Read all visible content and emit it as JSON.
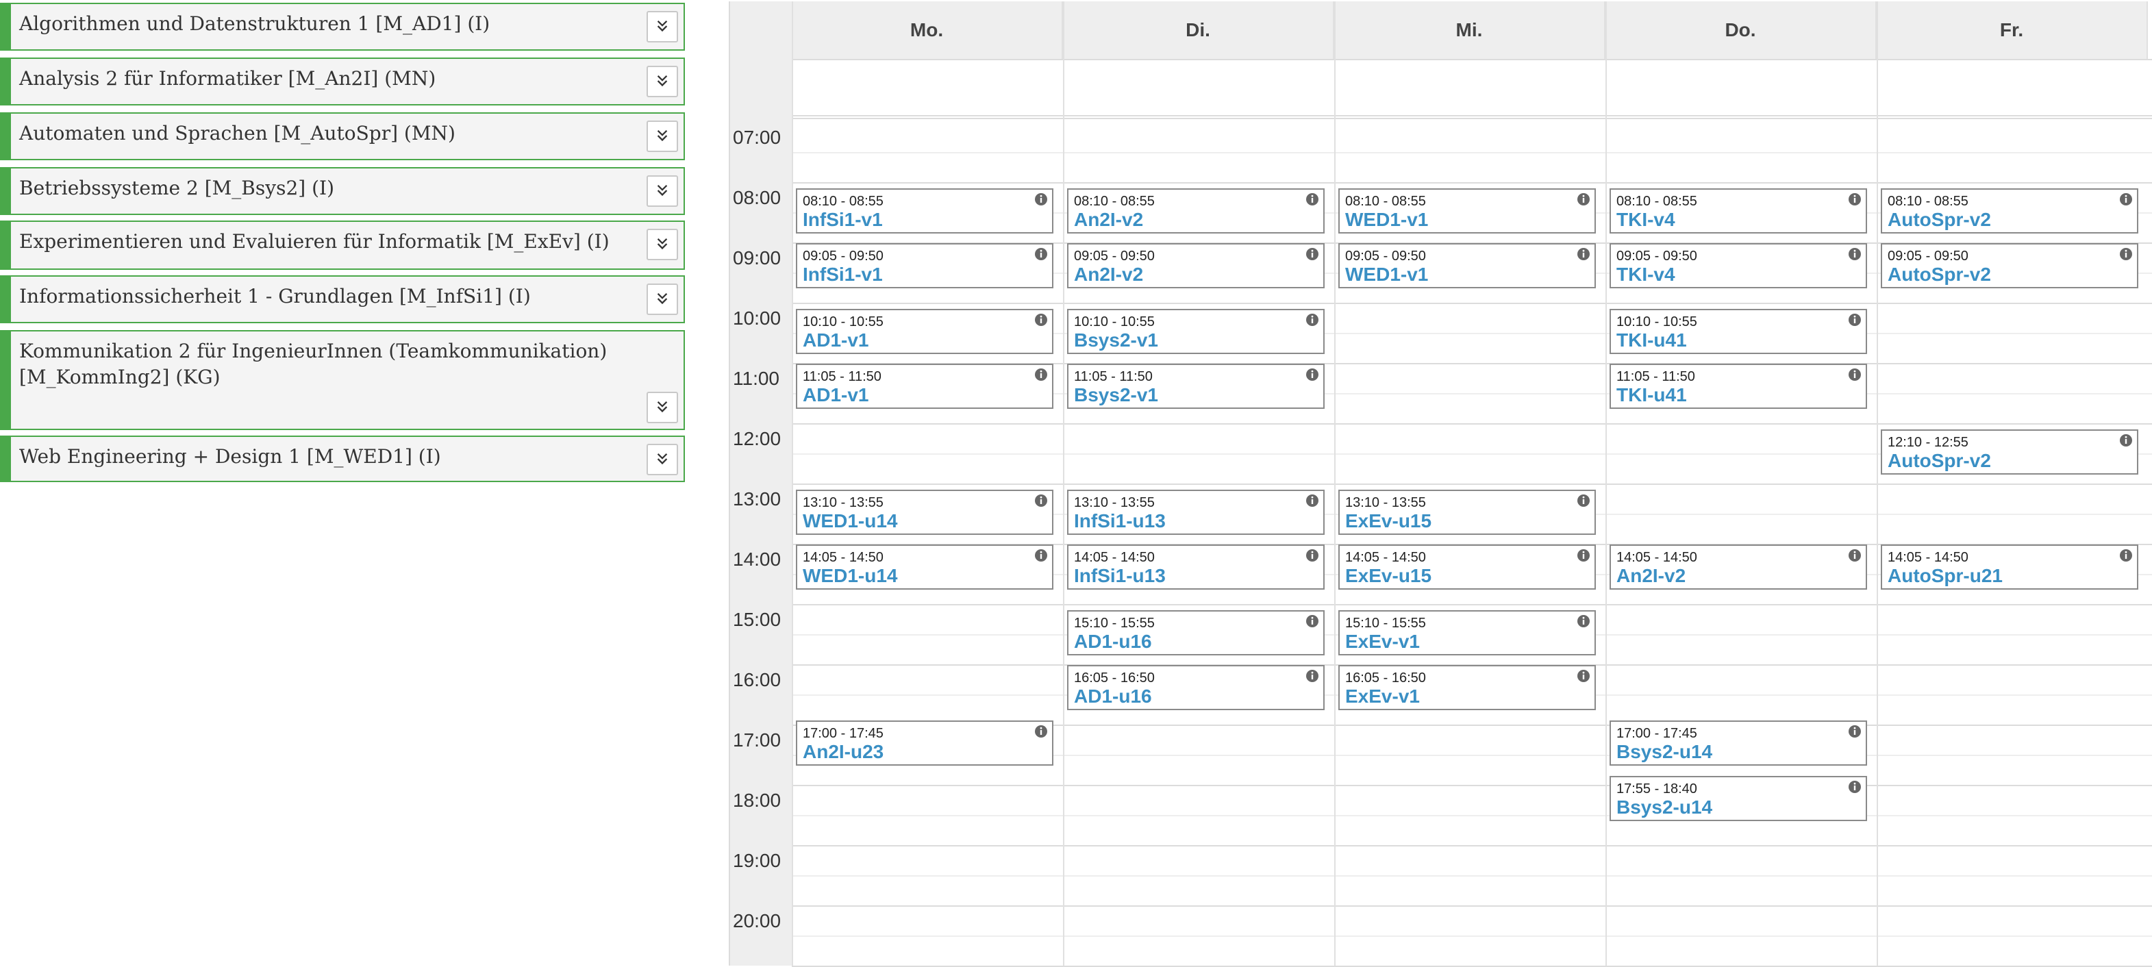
{
  "courses": [
    {
      "title": "Algorithmen und Datenstrukturen 1 [M_AD1] (I)"
    },
    {
      "title": "Analysis 2 für Informatiker [M_An2I] (MN)"
    },
    {
      "title": "Automaten und Sprachen [M_AutoSpr] (MN)"
    },
    {
      "title": "Betriebssysteme 2 [M_Bsys2] (I)"
    },
    {
      "title": "Experimentieren und Evaluieren für Informatik [M_ExEv] (I)"
    },
    {
      "title": "Informationssicherheit 1 - Grundlagen [M_InfSi1] (I)"
    },
    {
      "title": "Kommunikation 2 für IngenieurInnen (Teamkommunikation) [M_KommIng2] (KG)"
    },
    {
      "title": "Web Engineering + Design 1 [M_WED1] (I)"
    }
  ],
  "calendar": {
    "days": [
      "Mo.",
      "Di.",
      "Mi.",
      "Do.",
      "Fr."
    ],
    "hours": [
      "07:00",
      "08:00",
      "09:00",
      "10:00",
      "11:00",
      "12:00",
      "13:00",
      "14:00",
      "15:00",
      "16:00",
      "17:00",
      "18:00",
      "19:00",
      "20:00"
    ],
    "events": [
      {
        "day": 0,
        "time": "08:10 - 08:55",
        "name": "InfSi1-v1"
      },
      {
        "day": 1,
        "time": "08:10 - 08:55",
        "name": "An2I-v2"
      },
      {
        "day": 2,
        "time": "08:10 - 08:55",
        "name": "WED1-v1"
      },
      {
        "day": 3,
        "time": "08:10 - 08:55",
        "name": "TKI-v4"
      },
      {
        "day": 4,
        "time": "08:10 - 08:55",
        "name": "AutoSpr-v2"
      },
      {
        "day": 0,
        "time": "09:05 - 09:50",
        "name": "InfSi1-v1"
      },
      {
        "day": 1,
        "time": "09:05 - 09:50",
        "name": "An2I-v2"
      },
      {
        "day": 2,
        "time": "09:05 - 09:50",
        "name": "WED1-v1"
      },
      {
        "day": 3,
        "time": "09:05 - 09:50",
        "name": "TKI-v4"
      },
      {
        "day": 4,
        "time": "09:05 - 09:50",
        "name": "AutoSpr-v2"
      },
      {
        "day": 0,
        "time": "10:10 - 10:55",
        "name": "AD1-v1"
      },
      {
        "day": 1,
        "time": "10:10 - 10:55",
        "name": "Bsys2-v1"
      },
      {
        "day": 3,
        "time": "10:10 - 10:55",
        "name": "TKI-u41"
      },
      {
        "day": 0,
        "time": "11:05 - 11:50",
        "name": "AD1-v1"
      },
      {
        "day": 1,
        "time": "11:05 - 11:50",
        "name": "Bsys2-v1"
      },
      {
        "day": 3,
        "time": "11:05 - 11:50",
        "name": "TKI-u41"
      },
      {
        "day": 4,
        "time": "12:10 - 12:55",
        "name": "AutoSpr-v2"
      },
      {
        "day": 0,
        "time": "13:10 - 13:55",
        "name": "WED1-u14"
      },
      {
        "day": 1,
        "time": "13:10 - 13:55",
        "name": "InfSi1-u13"
      },
      {
        "day": 2,
        "time": "13:10 - 13:55",
        "name": "ExEv-u15"
      },
      {
        "day": 0,
        "time": "14:05 - 14:50",
        "name": "WED1-u14"
      },
      {
        "day": 1,
        "time": "14:05 - 14:50",
        "name": "InfSi1-u13"
      },
      {
        "day": 2,
        "time": "14:05 - 14:50",
        "name": "ExEv-u15"
      },
      {
        "day": 3,
        "time": "14:05 - 14:50",
        "name": "An2I-v2"
      },
      {
        "day": 4,
        "time": "14:05 - 14:50",
        "name": "AutoSpr-u21"
      },
      {
        "day": 1,
        "time": "15:10 - 15:55",
        "name": "AD1-u16"
      },
      {
        "day": 2,
        "time": "15:10 - 15:55",
        "name": "ExEv-v1"
      },
      {
        "day": 1,
        "time": "16:05 - 16:50",
        "name": "AD1-u16"
      },
      {
        "day": 2,
        "time": "16:05 - 16:50",
        "name": "ExEv-v1"
      },
      {
        "day": 0,
        "time": "17:00 - 17:45",
        "name": "An2I-u23"
      },
      {
        "day": 3,
        "time": "17:00 - 17:45",
        "name": "Bsys2-u14"
      },
      {
        "day": 3,
        "time": "17:55 - 18:40",
        "name": "Bsys2-u14"
      }
    ]
  },
  "colors": {
    "course_accent": "#4aa84a",
    "event_name": "#3a8fc4",
    "header_bg": "#eeeeee"
  },
  "icons": {
    "expand": "chevron-double-down-icon",
    "info": "info-icon"
  }
}
